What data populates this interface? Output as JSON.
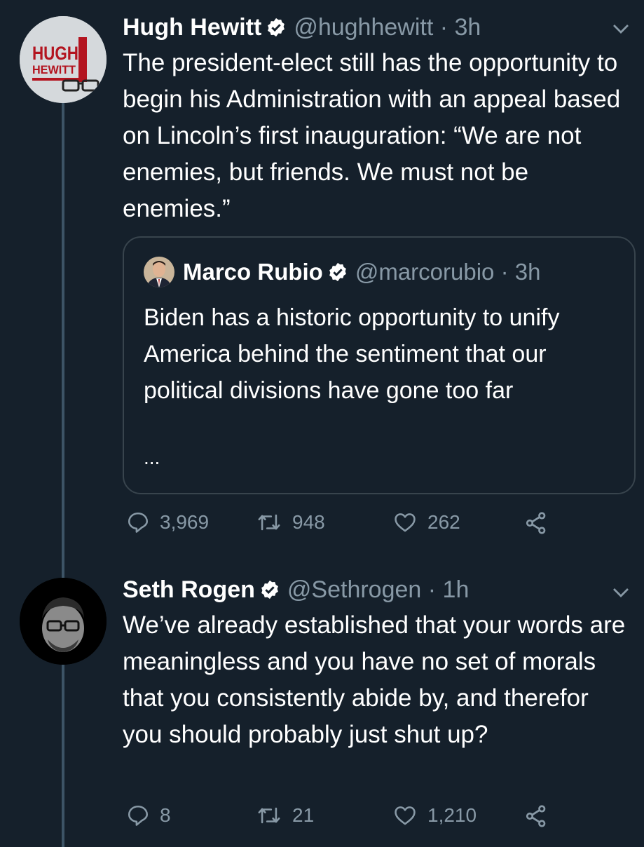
{
  "tweets": [
    {
      "author_name": "Hugh Hewitt",
      "handle_time": "@hughhewitt · 3h",
      "avatar_logo_line1": "HUGH",
      "avatar_logo_line2": "HEWITT",
      "text": "The president-elect still has the opportunity to begin his Administration with an appeal based on Lincoln’s first inauguration:  “We are not enemies, but friends. We must not be enemies.”",
      "quoted": {
        "author_name": "Marco Rubio",
        "handle_time": "@marcorubio · 3h",
        "text": "Biden has a historic opportunity to unify America behind the sentiment that our political divisions have gone too far",
        "more": "..."
      },
      "replies": "3,969",
      "retweets": "948",
      "likes": "262"
    },
    {
      "author_name": "Seth Rogen",
      "handle_time": "@Sethrogen · 1h",
      "text": "We’ve already established that your words are meaningless and you have no set of morals that you consistently abide by, and therefor you should probably just shut up?",
      "replies": "8",
      "retweets": "21",
      "likes": "1,210"
    }
  ],
  "colors": {
    "background": "#15202b",
    "text_primary": "#ffffff",
    "text_secondary": "#8899a6",
    "verified": "#ffffff",
    "border": "#38444d"
  },
  "icons": [
    "verified-badge-icon",
    "chevron-down-icon",
    "reply-icon",
    "retweet-icon",
    "like-icon",
    "share-icon"
  ]
}
